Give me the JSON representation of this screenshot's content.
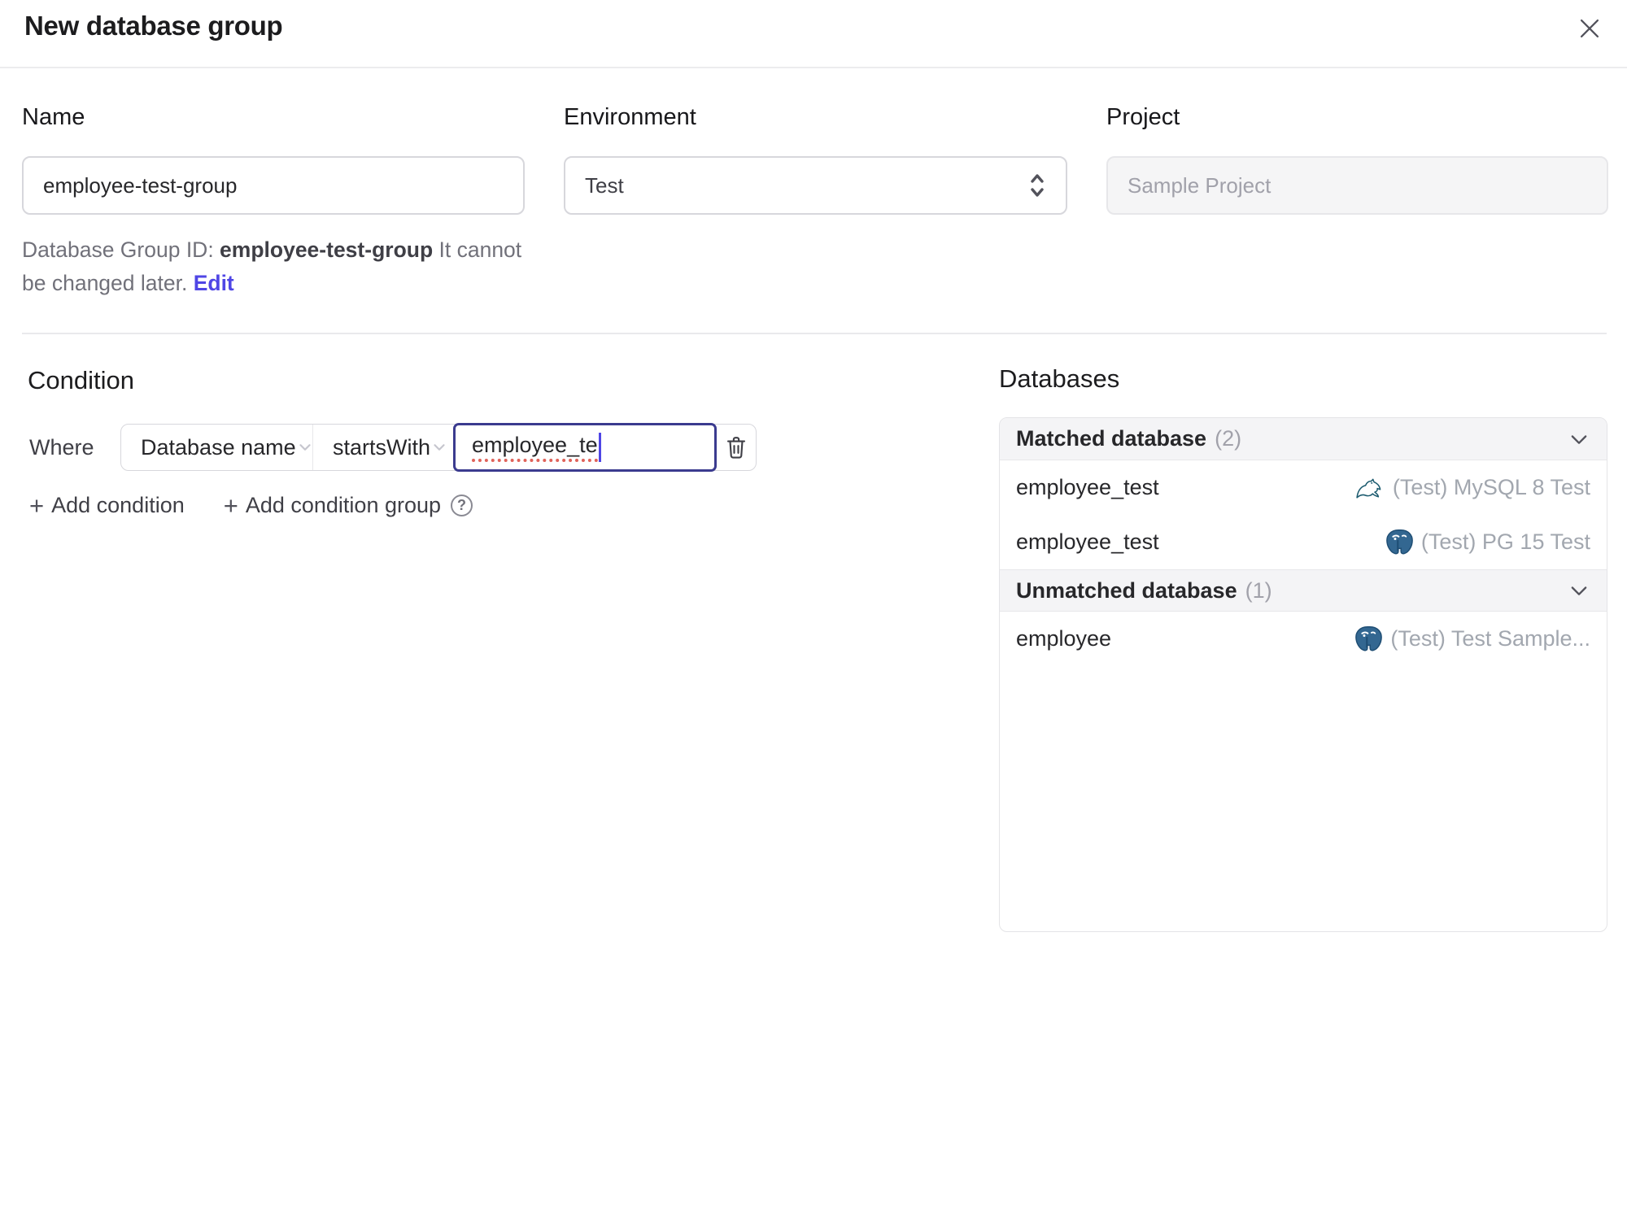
{
  "header": {
    "title": "New database group"
  },
  "form": {
    "name": {
      "label": "Name",
      "value": "employee-test-group"
    },
    "environment": {
      "label": "Environment",
      "value": "Test"
    },
    "project": {
      "label": "Project",
      "value": "Sample Project"
    },
    "group_id": {
      "prefix": "Database Group ID: ",
      "value": "employee-test-group",
      "note": " It cannot be changed later. ",
      "edit_label": "Edit"
    }
  },
  "condition": {
    "heading": "Condition",
    "where_label": "Where",
    "field": "Database name",
    "operator": "startsWith",
    "value": "employee_te",
    "plus": "+",
    "add_condition": "Add condition",
    "add_condition_group": "Add condition group",
    "help": "?"
  },
  "databases": {
    "heading": "Databases",
    "matched": {
      "title": "Matched database",
      "count": "(2)",
      "rows": [
        {
          "name": "employee_test",
          "engine": "mysql",
          "instance": "(Test) MySQL 8 Test"
        },
        {
          "name": "employee_test",
          "engine": "postgresql",
          "instance": "(Test) PG 15 Test"
        }
      ]
    },
    "unmatched": {
      "title": "Unmatched database",
      "count": "(1)",
      "rows": [
        {
          "name": "employee",
          "engine": "postgresql",
          "instance": "(Test) Test Sample..."
        }
      ]
    }
  },
  "colors": {
    "accent": "#4f46e5",
    "focus_border": "#3b3b8f",
    "input_border": "#d7d7dc",
    "panel_header_bg": "#f4f4f6",
    "muted_text": "#a2a7af",
    "spellcheck_dots": "#e0635a"
  }
}
